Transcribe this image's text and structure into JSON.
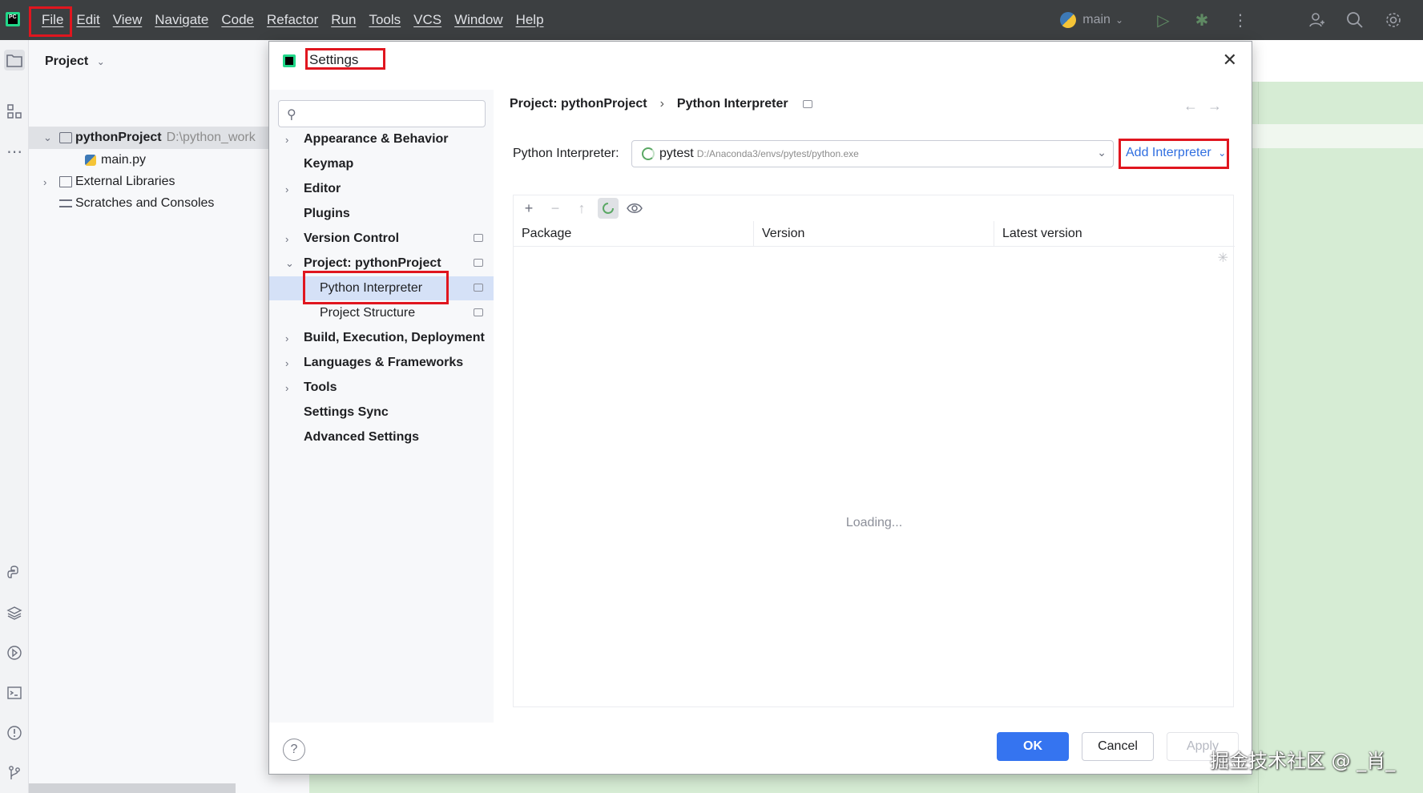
{
  "menu": [
    "File",
    "Edit",
    "View",
    "Navigate",
    "Code",
    "Refactor",
    "Run",
    "Tools",
    "VCS",
    "Window",
    "Help"
  ],
  "toolbar": {
    "branch": "main"
  },
  "project": {
    "header": "Project",
    "root_name": "pythonProject",
    "root_path": "D:\\python_work",
    "file": "main.py",
    "external": "External Libraries",
    "scratches": "Scratches and Consoles"
  },
  "dialog": {
    "title": "Settings",
    "nav": [
      "Appearance & Behavior",
      "Keymap",
      "Editor",
      "Plugins",
      "Version Control",
      "Project: pythonProject",
      "Python Interpreter",
      "Project Structure",
      "Build, Execution, Deployment",
      "Languages & Frameworks",
      "Tools",
      "Settings Sync",
      "Advanced Settings"
    ],
    "breadcrumb_parent": "Project: pythonProject",
    "breadcrumb_current": "Python Interpreter",
    "interpreter_label": "Python Interpreter:",
    "interpreter_name": "pytest",
    "interpreter_path": "D:/Anaconda3/envs/pytest/python.exe",
    "add_interpreter": "Add Interpreter",
    "columns": [
      "Package",
      "Version",
      "Latest version"
    ],
    "loading": "Loading...",
    "ok": "OK",
    "cancel": "Cancel",
    "apply": "Apply"
  },
  "watermark": "掘金技术社区 @ _肖_",
  "colors": {
    "accent": "#3574f0",
    "highlight_box": "#e0161f",
    "selection": "#d5e1f7"
  }
}
